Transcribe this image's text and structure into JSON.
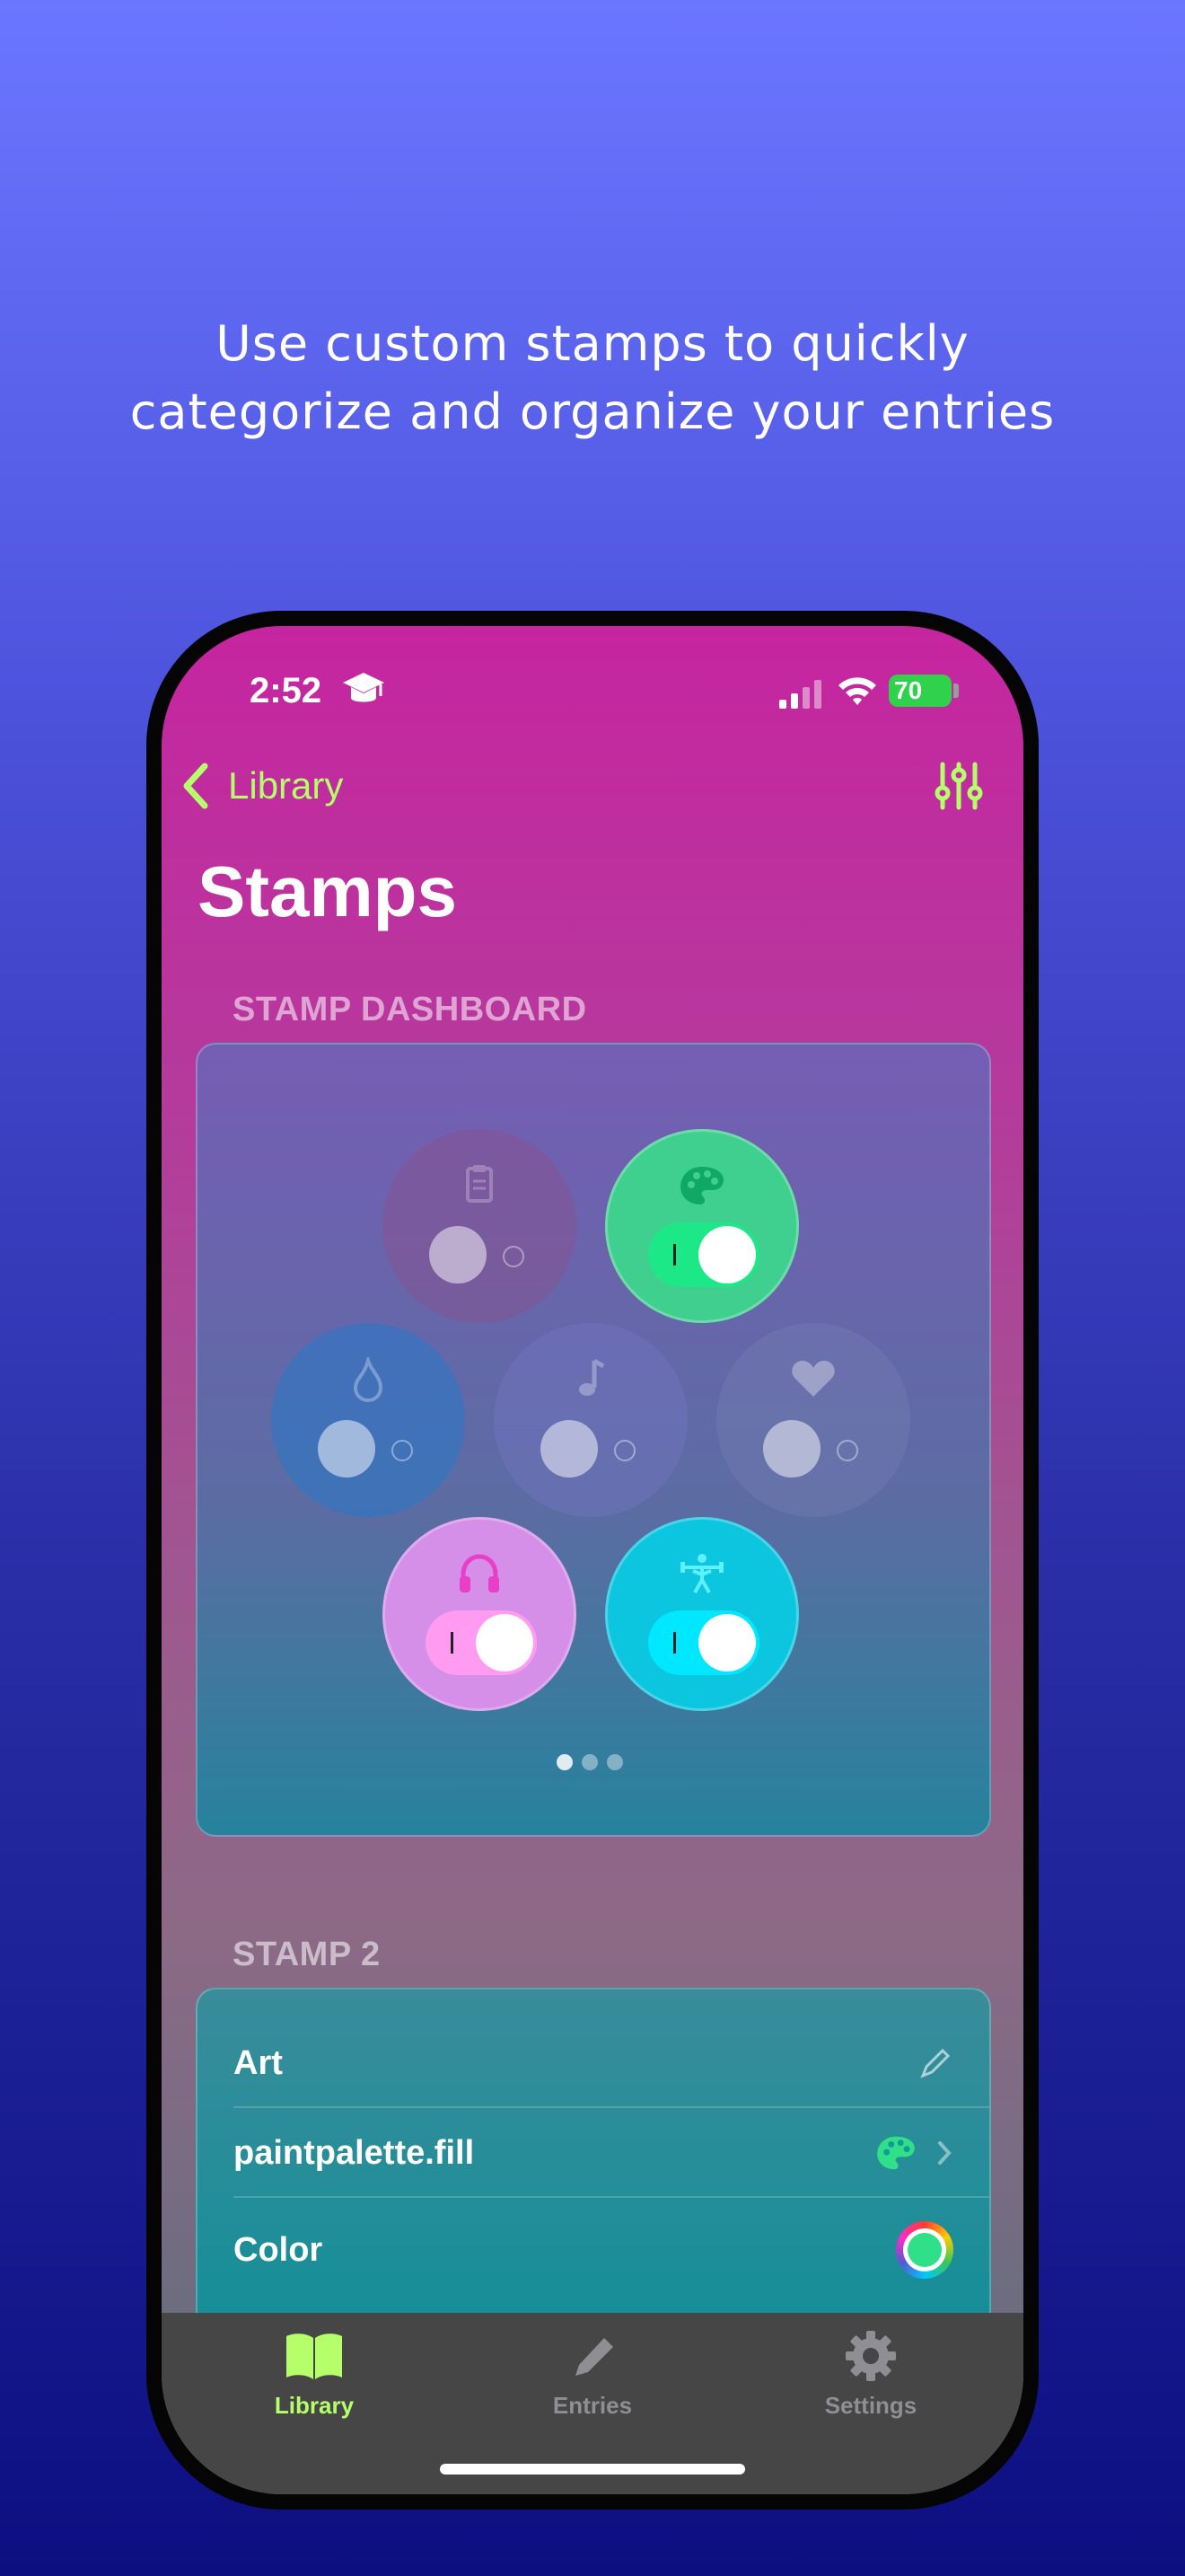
{
  "headline": {
    "line1": "Use custom stamps to quickly",
    "line2": "categorize and organize your entries"
  },
  "status_bar": {
    "time": "2:52",
    "battery": "70"
  },
  "nav": {
    "back_label": "Library",
    "title": "Stamps"
  },
  "dashboard": {
    "section_label": "STAMP DASHBOARD",
    "stamps": [
      {
        "icon": "clipboard-icon",
        "enabled": false,
        "color": "#7a5a9a"
      },
      {
        "icon": "paint-palette-icon",
        "enabled": true,
        "color": "#3fcf8e"
      },
      {
        "icon": "flame-icon",
        "enabled": false,
        "color": "#2f7fbf"
      },
      {
        "icon": "music-note-icon",
        "enabled": false,
        "color": "#6a72b0"
      },
      {
        "icon": "heart-icon",
        "enabled": false,
        "color": "#6e7fa8"
      },
      {
        "icon": "headphones-icon",
        "enabled": true,
        "color": "#d68fe8"
      },
      {
        "icon": "weightlifting-icon",
        "enabled": true,
        "color": "#0cc6e0"
      }
    ],
    "page_index": 0,
    "page_count": 3
  },
  "stamp_detail": {
    "section_label": "STAMP 2",
    "name": "Art",
    "symbol": "paintpalette.fill",
    "color_label": "Color",
    "accent": "#2fe089"
  },
  "tabbar": {
    "items": [
      {
        "label": "Library",
        "icon": "book-icon",
        "active": true
      },
      {
        "label": "Entries",
        "icon": "pencil-icon",
        "active": false
      },
      {
        "label": "Settings",
        "icon": "gear-icon",
        "active": false
      }
    ]
  },
  "colors": {
    "accent_green": "#b5ff6b",
    "screen_top": "#c625a0"
  }
}
